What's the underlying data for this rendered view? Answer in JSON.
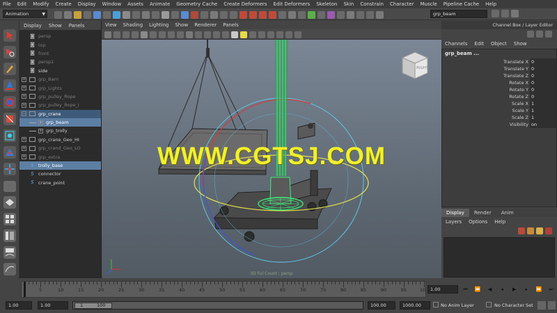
{
  "menubar": [
    "File",
    "Edit",
    "Modify",
    "Create",
    "Display",
    "Window",
    "Assets",
    "Animate",
    "Geometry Cache",
    "Create Deformers",
    "Edit Deformers",
    "Skeleton",
    "Skin",
    "Constrain",
    "Character",
    "Muscle",
    "Pipeline Cache",
    "Help"
  ],
  "statusline": {
    "mode": "Animation",
    "selection_field": "grp_beam"
  },
  "outliner": {
    "menu": [
      "Display",
      "Show",
      "Panels"
    ],
    "items": [
      {
        "label": "persp",
        "kind": "camera",
        "dim": true
      },
      {
        "label": "top",
        "kind": "camera",
        "dim": true
      },
      {
        "label": "front",
        "kind": "camera",
        "dim": true
      },
      {
        "label": "persp1",
        "kind": "camera",
        "dim": true
      },
      {
        "label": "side",
        "kind": "camera",
        "dim": false
      },
      {
        "label": "grp_Barn",
        "kind": "group",
        "dim": true
      },
      {
        "label": "grp_Lights",
        "kind": "group",
        "dim": true
      },
      {
        "label": "grp_pulley_Rope",
        "kind": "group",
        "dim": true
      },
      {
        "label": "grp_pulley_Rope_I",
        "kind": "group",
        "dim": true
      },
      {
        "label": "grp_crane",
        "kind": "group-open",
        "dim": false,
        "state": "hl"
      },
      {
        "label": "grp_beam",
        "kind": "child",
        "dim": false,
        "state": "sel"
      },
      {
        "label": "grp_trolly",
        "kind": "child",
        "dim": false
      },
      {
        "label": "grp_crane_Geo_HI",
        "kind": "group",
        "dim": false
      },
      {
        "label": "grp_crand_Geo_LO",
        "kind": "group",
        "dim": true
      },
      {
        "label": "grp_extra",
        "kind": "group",
        "dim": true
      },
      {
        "label": "trolly_base",
        "kind": "curve",
        "dim": false,
        "state": "sel"
      },
      {
        "label": "connector",
        "kind": "curve",
        "dim": false
      },
      {
        "label": "crane_point",
        "kind": "curve",
        "dim": false
      }
    ]
  },
  "viewport": {
    "menu": [
      "View",
      "Shading",
      "Lighting",
      "Show",
      "Renderer",
      "Panels"
    ],
    "watermark": "WWW.CGTSJ.COM",
    "viewcube_label": "RIGHT",
    "hud_label": "3D Ful Count : persp"
  },
  "channel_box": {
    "title": "Channel Box / Layer Editor",
    "menu": [
      "Channels",
      "Edit",
      "Object",
      "Show"
    ],
    "object": "grp_beam ...",
    "attributes": [
      {
        "name": "Translate X",
        "value": "0"
      },
      {
        "name": "Translate Y",
        "value": "0"
      },
      {
        "name": "Translate Z",
        "value": "0"
      },
      {
        "name": "Rotate X",
        "value": "0"
      },
      {
        "name": "Rotate Y",
        "value": "0"
      },
      {
        "name": "Rotate Z",
        "value": "0"
      },
      {
        "name": "Scale X",
        "value": "1"
      },
      {
        "name": "Scale Y",
        "value": "1"
      },
      {
        "name": "Scale Z",
        "value": "1"
      },
      {
        "name": "Visibility",
        "value": "on"
      }
    ]
  },
  "layer_editor": {
    "tabs": [
      "Display",
      "Render",
      "Anim"
    ],
    "active_tab": "Display",
    "menu": [
      "Layers",
      "Options",
      "Help"
    ]
  },
  "timeline": {
    "ticks": [
      "5",
      "10",
      "15",
      "20",
      "25",
      "30",
      "35",
      "40",
      "45",
      "50",
      "55",
      "60",
      "65",
      "70",
      "75",
      "80",
      "85",
      "90",
      "95",
      "10"
    ],
    "current_frame": "1.00",
    "playback": [
      "⏮",
      "⏪",
      "◀",
      "◂",
      "▶",
      "▸",
      "⏩",
      "⏭"
    ]
  },
  "range": {
    "start": "1.00",
    "playback_start": "1.00",
    "range_start_label": "1",
    "range_end_label": "100",
    "playback_end": "100.00",
    "end": "1000.00",
    "anim_layer": "No Anim Layer",
    "character_set": "No Character Set"
  },
  "colors": {
    "accent_selection": "#5d7fa4",
    "watermark": "#f2f02a",
    "beam_green": "#39f27a"
  }
}
